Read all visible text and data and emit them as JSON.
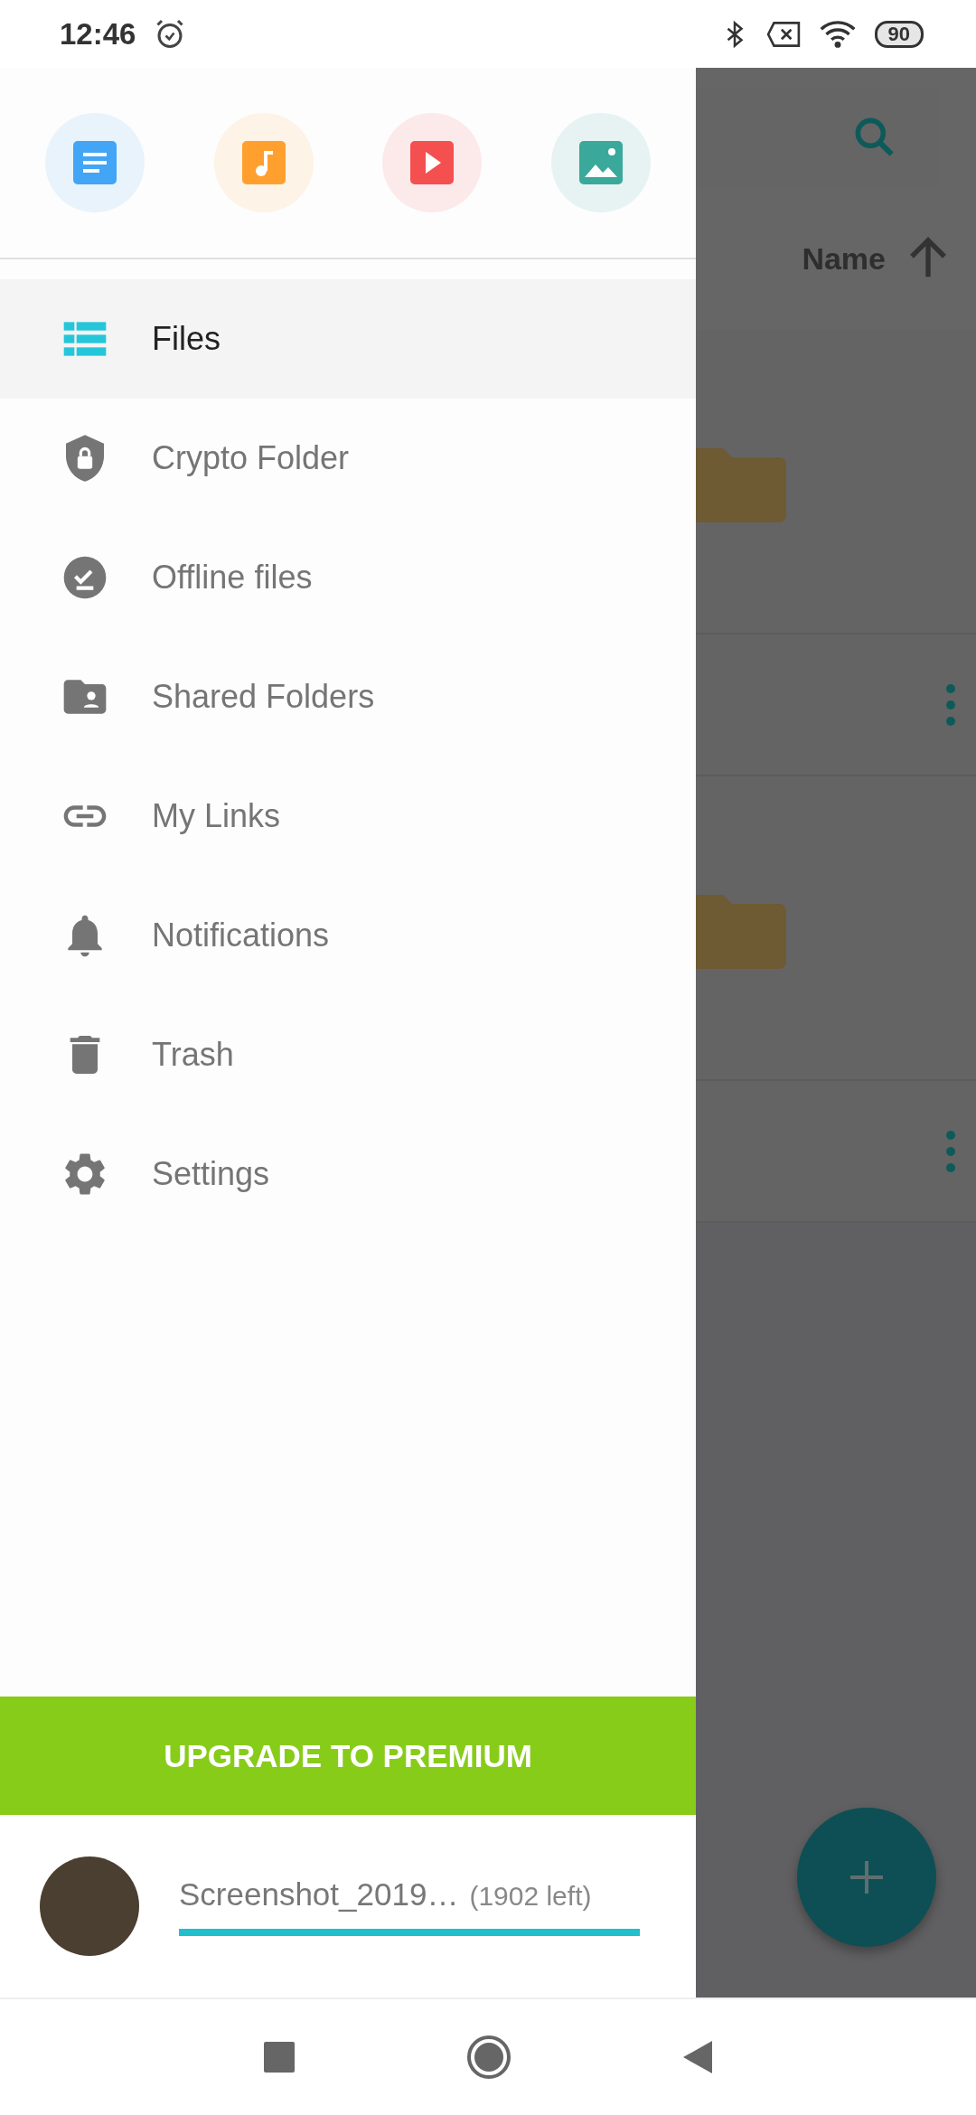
{
  "status_bar": {
    "time": "12:46",
    "battery": "90"
  },
  "quick_access": [
    {
      "kind": "documents",
      "color": "#42a5f5"
    },
    {
      "kind": "music",
      "color": "#ffa02e"
    },
    {
      "kind": "video",
      "color": "#f45050"
    },
    {
      "kind": "images",
      "color": "#3aa89a"
    }
  ],
  "drawer_items": [
    {
      "label": "Files",
      "kind": "files",
      "selected": true
    },
    {
      "label": "Crypto Folder",
      "kind": "crypto",
      "selected": false
    },
    {
      "label": "Offline files",
      "kind": "offline",
      "selected": false
    },
    {
      "label": "Shared Folders",
      "kind": "shared",
      "selected": false
    },
    {
      "label": "My Links",
      "kind": "links",
      "selected": false
    },
    {
      "label": "Notifications",
      "kind": "notifications",
      "selected": false
    },
    {
      "label": "Trash",
      "kind": "trash",
      "selected": false
    },
    {
      "label": "Settings",
      "kind": "settings",
      "selected": false
    }
  ],
  "upgrade_button": "UPGRADE TO PREMIUM",
  "account": {
    "name": "Screenshot_2019…",
    "quota": "(1902 left)",
    "level": 1
  },
  "background": {
    "sort_label": "Name"
  }
}
